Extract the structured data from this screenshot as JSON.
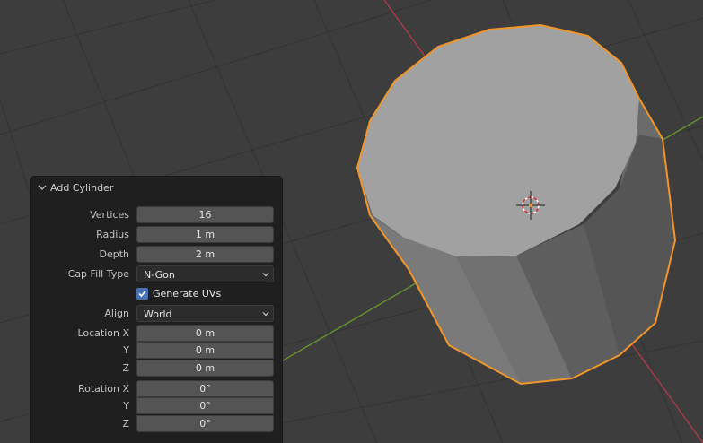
{
  "panel": {
    "title": "Add Cylinder",
    "vertices": {
      "label": "Vertices",
      "value": "16"
    },
    "radius": {
      "label": "Radius",
      "value": "1 m"
    },
    "depth": {
      "label": "Depth",
      "value": "2 m"
    },
    "cap_fill": {
      "label": "Cap Fill Type",
      "value": "N-Gon"
    },
    "generate_uvs": {
      "label": "Generate UVs",
      "checked": true
    },
    "align": {
      "label": "Align",
      "value": "World"
    },
    "location": {
      "x_label": "Location X",
      "x": "0 m",
      "y_label": "Y",
      "y": "0 m",
      "z_label": "Z",
      "z": "0 m"
    },
    "rotation": {
      "x_label": "Rotation X",
      "x": "0°",
      "y_label": "Y",
      "y": "0°",
      "z_label": "Z",
      "z": "0°"
    }
  },
  "colors": {
    "viewport_bg": "#3d3d3d",
    "x_axis": "#b23a48",
    "y_axis": "#6a9a2a",
    "selection_outline": "#f0962a",
    "checkbox_accent": "#4772b3"
  },
  "icons": [
    "chevron-down-icon",
    "dropdown-arrow-icon",
    "checkmark-icon",
    "3d-cursor-icon"
  ]
}
